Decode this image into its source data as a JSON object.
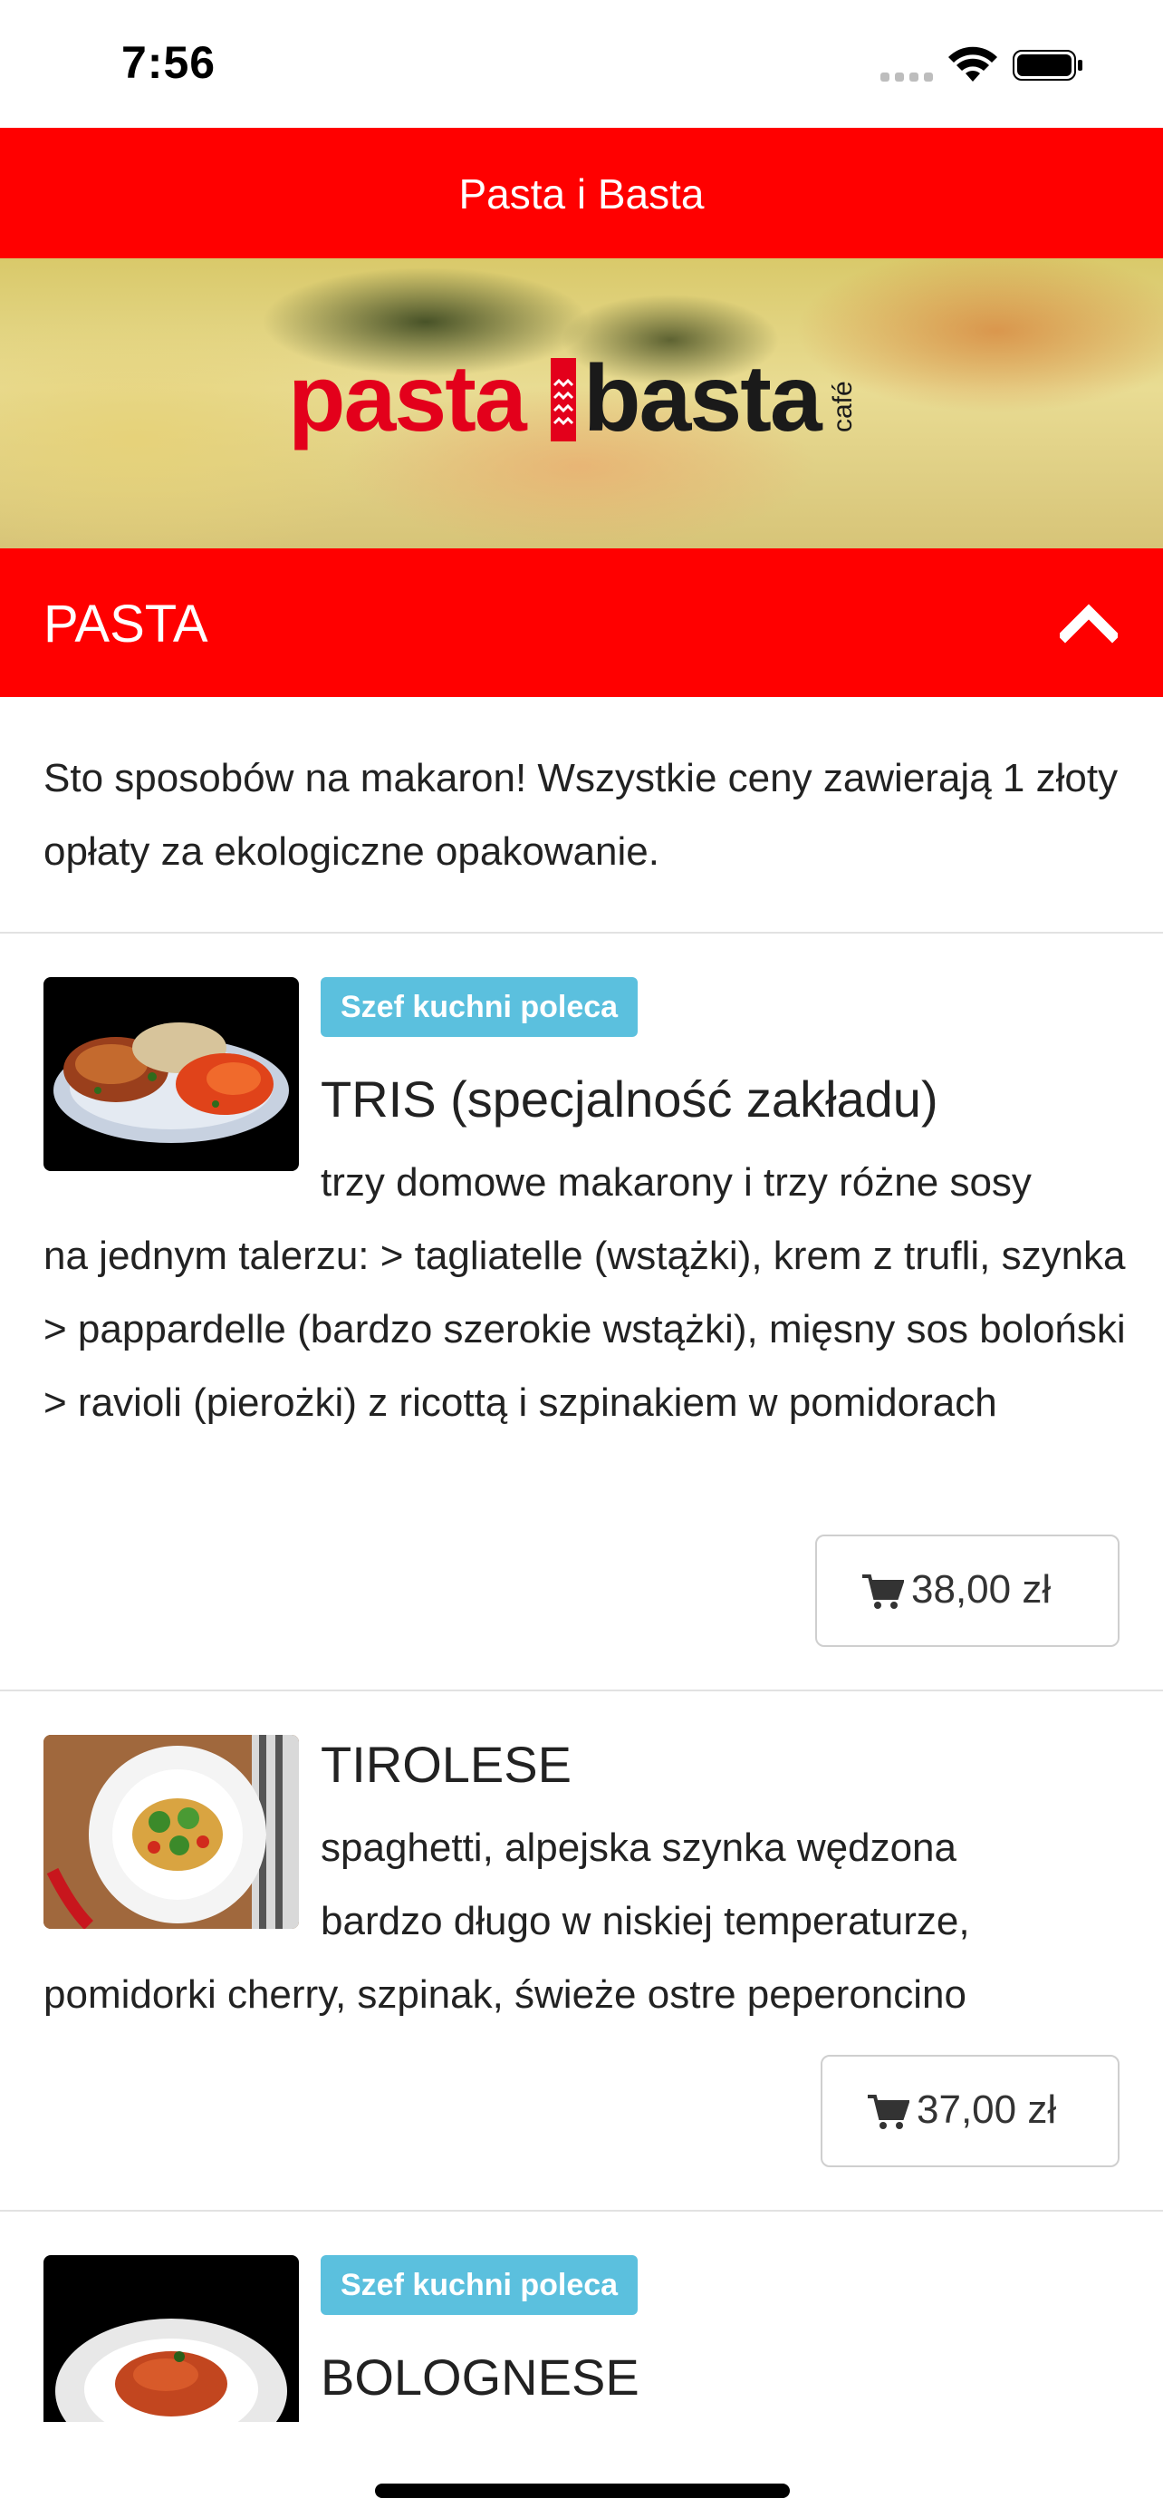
{
  "status_bar": {
    "time": "7:56"
  },
  "header": {
    "title": "Pasta i Basta"
  },
  "banner": {
    "logo_text_red": "pasta",
    "logo_text_dark": "basta",
    "logo_text_small": "café"
  },
  "category": {
    "title": "PASTA",
    "description": "Sto sposobów na makaron! Wszystkie ceny zawierają 1 złoty opłaty za ekologiczne opakowanie."
  },
  "items": [
    {
      "badge": "Szef kuchni poleca",
      "name": "TRIS (specjalność zakładu)",
      "desc_line1": "trzy domowe makarony i trzy różne sosy",
      "desc_rest": "na jednym talerzu: > tagliatelle (wstążki), krem z trufli, szynka > pappardelle (bardzo szerokie wstążki), mięsny sos boloński > ravioli (pierożki) z ricottą i szpinakiem w pomidorach",
      "price": "38,00 zł"
    },
    {
      "name": "TIROLESE",
      "desc_line1": "spaghetti, alpejska szynka wędzona",
      "desc_line2": "bardzo długo w niskiej temperaturze,",
      "desc_rest": "pomidorki cherry, szpinak, świeże ostre peperoncino",
      "price": "37,00 zł"
    },
    {
      "badge": "Szef kuchni poleca",
      "name": "BOLOGNESE"
    }
  ],
  "icons": {
    "cart": "shopping-cart-icon",
    "collapse": "chevron-up-icon"
  },
  "colors": {
    "brand_red": "#ff0000",
    "badge_blue": "#5bc0de"
  }
}
